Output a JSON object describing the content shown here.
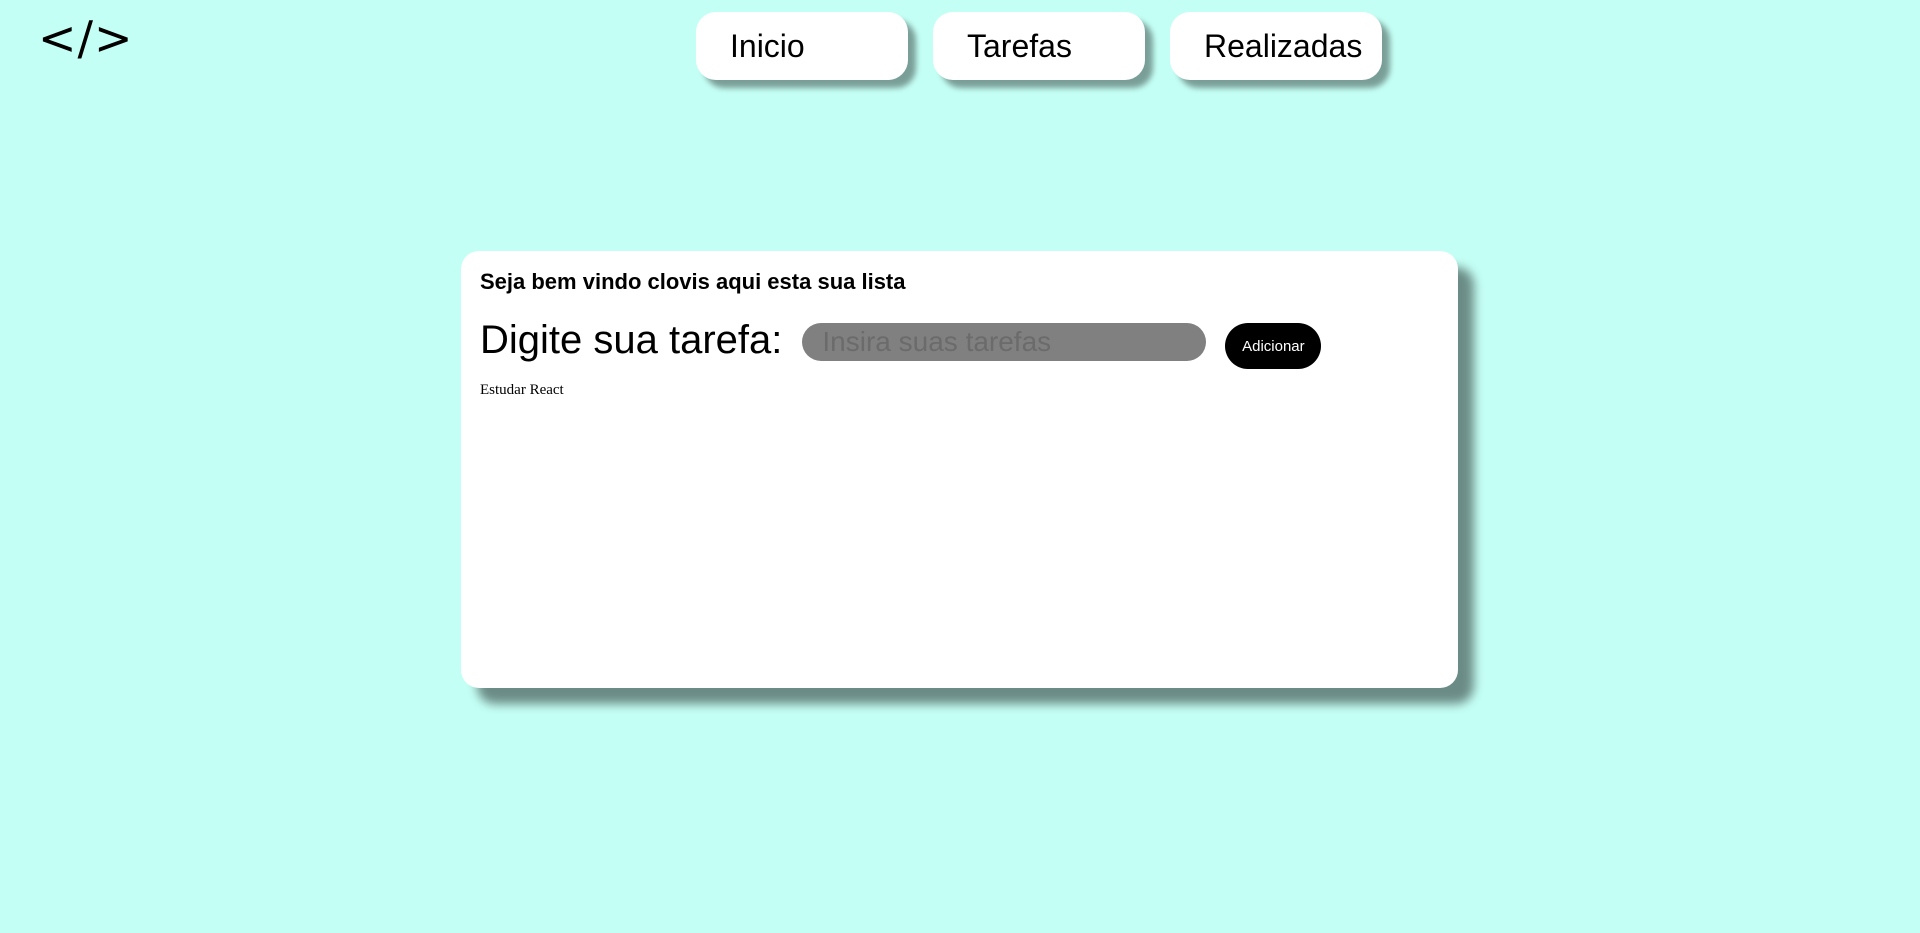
{
  "logo": {
    "text": "</>",
    "icon": "code-icon"
  },
  "nav": {
    "items": [
      {
        "label": "Inicio"
      },
      {
        "label": "Tarefas"
      },
      {
        "label": "Realizadas"
      }
    ]
  },
  "main": {
    "welcome": "Seja bem vindo clovis aqui esta sua lista",
    "input_label": "Digite sua tarefa:",
    "input_value": "",
    "input_placeholder": "Insira suas tarefas",
    "add_button_label": "Adicionar",
    "tasks": [
      {
        "text": "Estudar React"
      }
    ]
  },
  "colors": {
    "background": "#c4fff5",
    "card": "#ffffff",
    "input": "#808080",
    "button": "#000000"
  }
}
